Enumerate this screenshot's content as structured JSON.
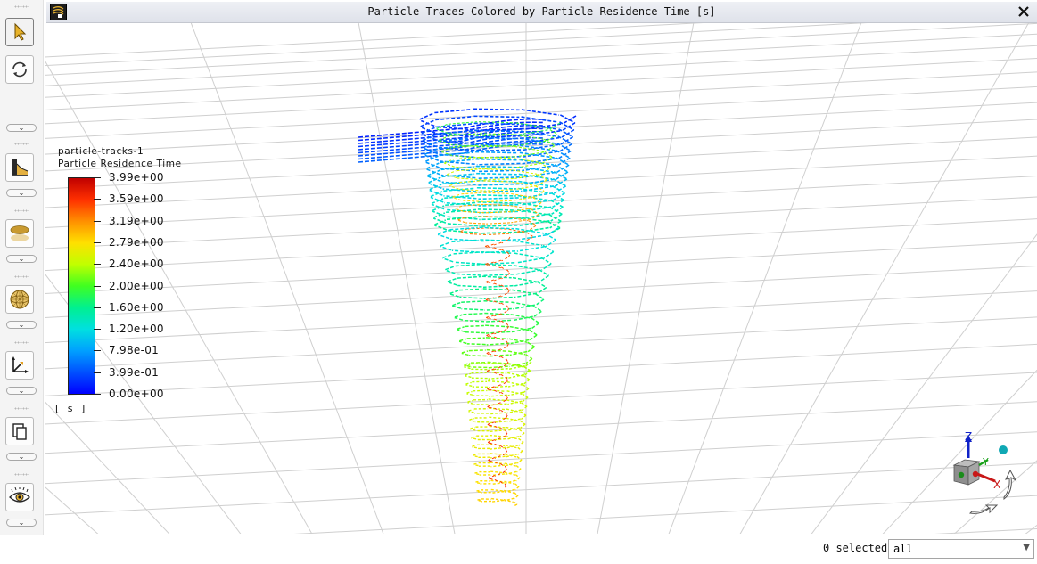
{
  "window": {
    "title": "Particle Traces Colored by Particle Residence Time [s]",
    "close_label": "×"
  },
  "toolbar": {
    "icons": [
      "pointer-icon",
      "rotate-icon",
      "contours-icon",
      "surface-icon",
      "mesh-sphere-icon",
      "axes-icon",
      "copy-icon",
      "view-icon"
    ],
    "dropdown_glyph": "⌄"
  },
  "legend": {
    "object_name": "particle-tracks-1",
    "quantity": "Particle Residence Time",
    "unit": "[ s ]",
    "ticks": [
      "3.99e+00",
      "3.59e+00",
      "3.19e+00",
      "2.79e+00",
      "2.40e+00",
      "2.00e+00",
      "1.60e+00",
      "1.20e+00",
      "7.98e-01",
      "3.99e-01",
      "0.00e+00"
    ],
    "colors": {
      "min": "#0000ff",
      "max": "#c00000"
    }
  },
  "triad": {
    "axes": [
      "Z",
      "Y",
      "X"
    ]
  },
  "status": {
    "selected_text": "0 selected",
    "filter_value": "all"
  }
}
